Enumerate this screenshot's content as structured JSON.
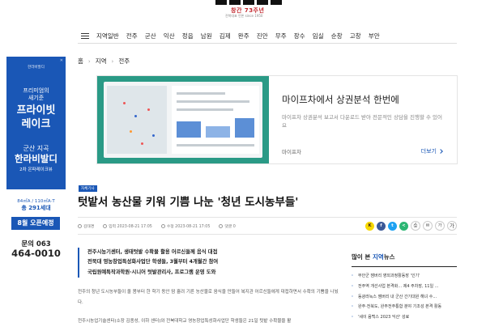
{
  "masthead": {
    "anniversary": "창간 73주년",
    "tagline": "전북대표 언론 since 1950"
  },
  "nav": {
    "items": [
      "지역일반",
      "전주",
      "군산",
      "익산",
      "정읍",
      "남원",
      "김제",
      "완주",
      "진안",
      "무주",
      "장수",
      "임실",
      "순창",
      "고창",
      "부안"
    ]
  },
  "breadcrumb": {
    "home": "홈",
    "level1": "지역",
    "level2": "전주"
  },
  "left_ad": {
    "brand": "한라비발디",
    "line1": "프리미엄의",
    "line1b": "새기준",
    "line2a": "프라이빗",
    "line2b": "레이크",
    "line3": "군산 지곡",
    "line4": "한라비발디",
    "line5": "2차 온파레이크뷰",
    "info1": "84㎡A / 110㎡A·T",
    "info2": "총 291세대",
    "open": "8월 오픈예정",
    "tel_label": "문의 063",
    "tel_number": "464-0010"
  },
  "banner": {
    "title": "마이프차에서 상권분석 한번에",
    "desc": "마이프차 상권분석 보고서 다운로드 받아 전문적인 상담을 진행할 수 있어요",
    "source": "마이프차",
    "more": "더보기"
  },
  "article": {
    "section": "자체기사",
    "headline": "텃밭서 농산물 키워 기쁨 나눈 '청년 도시농부들'",
    "reporter": "김태경",
    "published": "입력 2023-08-21 17:05",
    "updated": "수정 2023-08-21 17:05",
    "comments": "댓글 0",
    "summary": [
      "전주시농기센터, 생태텃밭 수확물 활용 어르신들께 음식 대접",
      "전북대 영농창업특성화사업단 학생들, 3월부터 4개월간 참여",
      "국립원예특작과학원·시니어 텃밭관리사, 프로그램 운영 도와"
    ],
    "body1": "전주의 청년 도시농부들이 올 봄부터 한 학기 동안 땀 흘려 기른 농산물로 음식을 만들어 복지관 어르신들에게 대접하면서 수확의 기쁨을 나눴다.",
    "body2": "전주시농업기술센터(소장 김종성, 이하 센터)와 전북대학교 영농창업특성화사업단 학생들은 21일 텃밭 수확물을 활"
  },
  "share": {
    "kakao": "K",
    "facebook": "f",
    "twitter": "t",
    "share": "<"
  },
  "tools": {
    "print": "⎙",
    "scrap": "✉",
    "font_small": "가",
    "font_large": "가"
  },
  "popular": {
    "title_prefix": "많이 본 ",
    "title_highlight": "지역",
    "title_suffix": "뉴스",
    "items": [
      "부안군 잼버리 영외과정활동장 '인기'",
      "전주역 개선사업 본격화… 제4 주차장, 11일 ...",
      "동광라녹스 잼버리 내 군산 간기대원 해녀 수...",
      "완주·전북도, 완주전주통합 분야 기조성 본격 활동",
      "'세이 음백스 2023 익산' 성료"
    ]
  },
  "colors": {
    "brand_blue": "#1a57b6",
    "accent_red": "#c1272d",
    "banner_green": "#2a9a86"
  }
}
